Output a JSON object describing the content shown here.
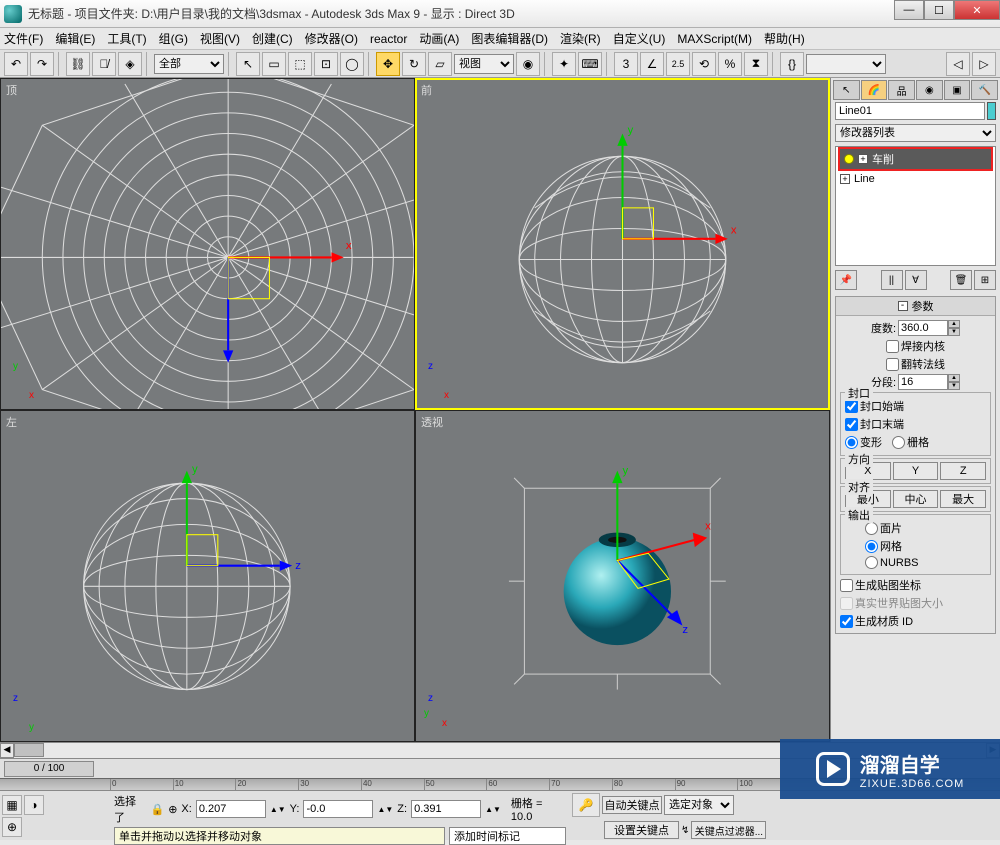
{
  "title": "无标题    - 项目文件夹: D:\\用户目录\\我的文档\\3dsmax      - Autodesk 3ds Max 9      - 显示 : Direct 3D",
  "menu": [
    "文件(F)",
    "编辑(E)",
    "工具(T)",
    "组(G)",
    "视图(V)",
    "创建(C)",
    "修改器(O)",
    "reactor",
    "动画(A)",
    "图表编辑器(D)",
    "渲染(R)",
    "自定义(U)",
    "MAXScript(M)",
    "帮助(H)"
  ],
  "toolbar_selection_filter": "全部",
  "toolbar_refsys": "视图",
  "viewports": {
    "top": "顶",
    "front": "前",
    "left": "左",
    "persp": "透视"
  },
  "object_name": "Line01",
  "modifier_list_label": "修改器列表",
  "stack": {
    "lathe": "车削",
    "line": "Line"
  },
  "params": {
    "header": "参数",
    "degrees_label": "度数:",
    "degrees": "360.0",
    "weld_core": "焊接内核",
    "flip_normals": "翻转法线",
    "segments_label": "分段:",
    "segments": "16",
    "cap_group": "封口",
    "cap_start": "封口始端",
    "cap_end": "封口末端",
    "morph": "变形",
    "grid": "栅格",
    "dir_group": "方向",
    "x": "X",
    "y": "Y",
    "z": "Z",
    "align_group": "对齐",
    "min": "最小",
    "center": "中心",
    "max": "最大",
    "output_group": "输出",
    "patch": "面片",
    "mesh": "网格",
    "nurbs": "NURBS",
    "gen_map": "生成贴图坐标",
    "realworld": "真实世界贴图大小",
    "gen_mat": "生成材质 ID"
  },
  "timeline": {
    "frame": "0 / 100"
  },
  "status": {
    "sel_label": "选择了",
    "x_label": "X:",
    "x": "0.207",
    "y_label": "Y:",
    "y": "-0.0",
    "z_label": "Z:",
    "z": "0.391",
    "grid_label": "栅格 = 10.0",
    "prompt": "单击并拖动以选择并移动对象",
    "addtime": "添加时间标记",
    "autokey": "自动关键点",
    "selobj": "选定对象",
    "setkey": "设置关键点",
    "keyfilter": "关键点过滤器..."
  },
  "watermark": {
    "title": "溜溜自学",
    "url": "ZIXUE.3D66.COM"
  }
}
